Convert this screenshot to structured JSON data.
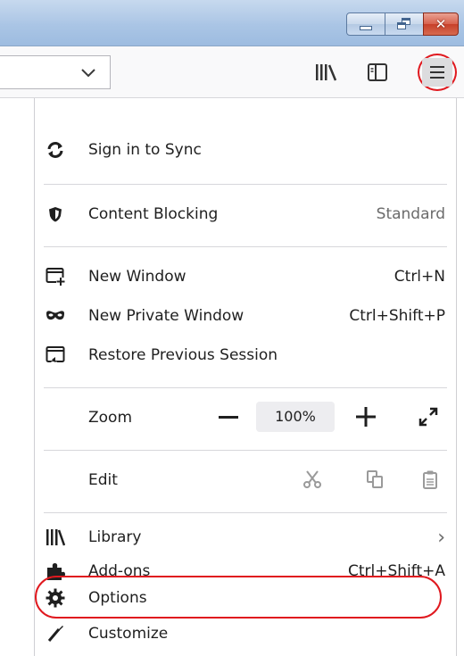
{
  "window": {
    "controls": [
      {
        "name": "minimize",
        "icon": "minimize-icon"
      },
      {
        "name": "maximize",
        "icon": "restore-icon"
      },
      {
        "name": "close",
        "icon": "close-icon",
        "glyph": "✕"
      }
    ]
  },
  "toolbar": {
    "url_dropdown_icon": "chevron-down-icon",
    "library_icon": "library-icon",
    "sidebar_icon": "sidebar-icon",
    "menu_icon": "hamburger-menu-icon",
    "highlight_color": "#e0191f"
  },
  "menu": {
    "sync": {
      "label": "Sign in to Sync",
      "icon": "sync-icon"
    },
    "content_blocking": {
      "label": "Content Blocking",
      "value": "Standard",
      "icon": "shield-icon"
    },
    "new_window": {
      "label": "New Window",
      "shortcut": "Ctrl+N",
      "icon": "new-window-icon"
    },
    "new_private_window": {
      "label": "New Private Window",
      "shortcut": "Ctrl+Shift+P",
      "icon": "private-mask-icon"
    },
    "restore_session": {
      "label": "Restore Previous Session",
      "icon": "restore-session-icon"
    },
    "zoom": {
      "label": "Zoom",
      "value": "100%",
      "icons": [
        "zoom-out-icon",
        "zoom-in-icon",
        "fullscreen-icon"
      ]
    },
    "edit": {
      "label": "Edit",
      "icons": [
        "cut-icon",
        "copy-icon",
        "paste-icon"
      ]
    },
    "library": {
      "label": "Library",
      "arrow": "›",
      "icon": "library-icon"
    },
    "addons": {
      "label": "Add-ons",
      "shortcut": "Ctrl+Shift+A",
      "icon": "puzzle-icon"
    },
    "options": {
      "label": "Options",
      "icon": "gear-icon"
    },
    "customize": {
      "label": "Customize",
      "icon": "paintbrush-icon"
    }
  }
}
